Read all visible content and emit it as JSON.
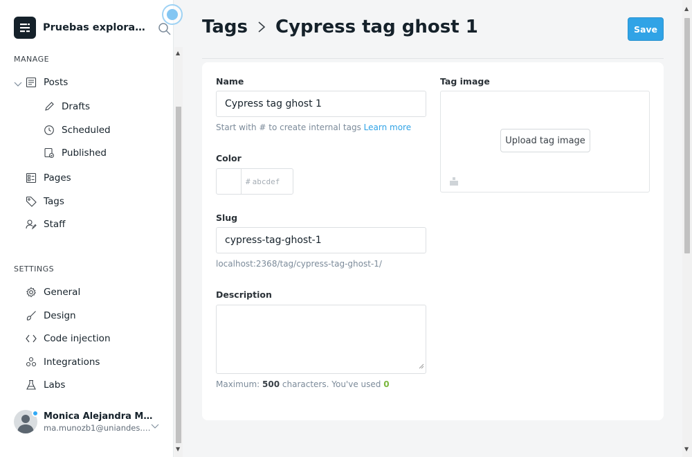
{
  "sidebar": {
    "site_name": "Pruebas explorato...",
    "manage_title": "MANAGE",
    "settings_title": "SETTINGS",
    "manage_items": [
      {
        "label": "Posts",
        "icon": "posts-icon"
      },
      {
        "label": "Drafts",
        "icon": "pencil-icon"
      },
      {
        "label": "Scheduled",
        "icon": "clock-icon"
      },
      {
        "label": "Published",
        "icon": "published-icon"
      },
      {
        "label": "Pages",
        "icon": "pages-icon"
      },
      {
        "label": "Tags",
        "icon": "tag-icon"
      },
      {
        "label": "Staff",
        "icon": "staff-icon"
      }
    ],
    "settings_items": [
      {
        "label": "General",
        "icon": "gear-icon"
      },
      {
        "label": "Design",
        "icon": "brush-icon"
      },
      {
        "label": "Code injection",
        "icon": "code-icon"
      },
      {
        "label": "Integrations",
        "icon": "integrations-icon"
      },
      {
        "label": "Labs",
        "icon": "flask-icon"
      }
    ],
    "user": {
      "name": "Monica Alejandra Muñ...",
      "email": "ma.munozb1@uniandes.e..."
    }
  },
  "header": {
    "breadcrumb_parent": "Tags",
    "breadcrumb_current": "Cypress tag ghost 1",
    "save_label": "Save"
  },
  "form": {
    "name_label": "Name",
    "name_value": "Cypress tag ghost 1",
    "name_hint": "Start with # to create internal tags",
    "name_hint_link": "Learn more",
    "color_label": "Color",
    "color_hash": "#",
    "color_placeholder": "abcdef",
    "slug_label": "Slug",
    "slug_value": "cypress-tag-ghost-1",
    "slug_url": "localhost:2368/tag/cypress-tag-ghost-1/",
    "description_label": "Description",
    "description_value": "",
    "count_prefix": "Maximum:",
    "count_max": "500",
    "count_middle": "characters. You've used",
    "count_used": "0",
    "tag_image_label": "Tag image",
    "upload_label": "Upload tag image"
  },
  "colors": {
    "accent": "#30a3e6",
    "count_used": "#7bb73e"
  }
}
